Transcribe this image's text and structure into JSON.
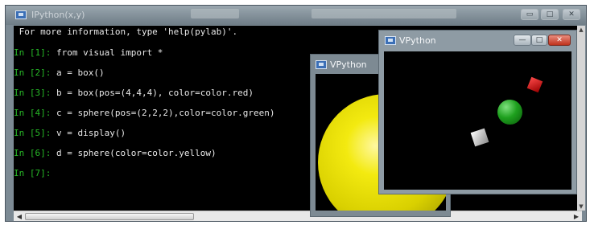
{
  "ipython_window": {
    "title": "IPython(x,y)",
    "controls": {
      "minimize": "▭",
      "maximize": "□",
      "close": "✕"
    }
  },
  "console": {
    "intro": " For more information, type 'help(pylab)'.",
    "lines": [
      {
        "prompt": "In [1]:",
        "code": " from visual import *"
      },
      {
        "prompt": "In [2]:",
        "code": " a = box()"
      },
      {
        "prompt": "In [3]:",
        "code": " b = box(pos=(4,4,4), color=color.red)"
      },
      {
        "prompt": "In [4]:",
        "code": " c = sphere(pos=(2,2,2),color=color.green)"
      },
      {
        "prompt": "In [5]:",
        "code": " v = display()"
      },
      {
        "prompt": "In [6]:",
        "code": " d = sphere(color=color.yellow)"
      },
      {
        "prompt": "In [7]:",
        "code": ""
      }
    ]
  },
  "vpython_window_back": {
    "title": "VPython"
  },
  "vpython_window_front": {
    "title": "VPython",
    "controls": {
      "minimize": "—",
      "maximize": "□",
      "close": "✕"
    }
  },
  "scrollbars": {
    "left_arrow": "◀",
    "right_arrow": "▶",
    "up_arrow": "▲",
    "down_arrow": "▼"
  },
  "colors": {
    "prompt": "#27b827",
    "console_bg": "#000000",
    "sphere_yellow": "#e6dd00",
    "sphere_green": "#1ea01e",
    "box_red": "#d21a1a",
    "box_white": "#d9d9d9"
  }
}
